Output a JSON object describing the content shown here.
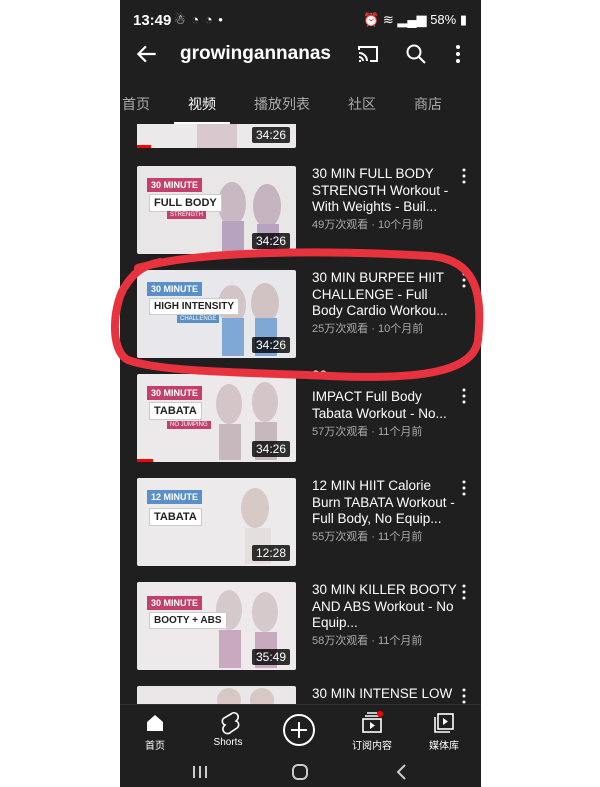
{
  "status": {
    "time": "13:49",
    "battery": "58%",
    "notif_icons": "☃ ◔ ◔ •"
  },
  "header": {
    "channel": "growingannanas"
  },
  "tabs": [
    "首页",
    "视频",
    "播放列表",
    "社区",
    "商店"
  ],
  "active_tab": "视频",
  "videos": [
    {
      "duration": "34:26"
    },
    {
      "title": "30 MIN FULL BODY STRENGTH Workout - With Weights - Buil...",
      "meta": "49万次观看 · 10个月前",
      "duration": "34:26",
      "thumb": {
        "tag": "30 MINUTE",
        "main": "FULL BODY",
        "sub": "STRENGTH"
      }
    },
    {
      "title": "30 MIN BURPEE HIIT CHALLENGE - Full Body Cardio Workou...",
      "meta": "25万次观看 · 10个月前",
      "duration": "34:26",
      "thumb": {
        "tag": "30 MINUTE",
        "main": "HIGH INTENSITY",
        "sub": "CHALLENGE"
      }
    },
    {
      "title_partial": "30",
      "title": "IMPACT Full Body Tabata Workout - No...",
      "meta": "57万次观看 · 11个月前",
      "duration": "34:26",
      "thumb": {
        "tag": "30 MINUTE",
        "main": "TABATA",
        "sub": "NO JUMPING"
      }
    },
    {
      "title": "12 MIN HIIT Calorie Burn TABATA Workout - Full Body, No Equip...",
      "meta": "55万次观看 · 11个月前",
      "duration": "12:28",
      "thumb": {
        "tag": "12 MINUTE",
        "main": "TABATA"
      }
    },
    {
      "title": "30 MIN KILLER BOOTY AND ABS Workout - No Equip...",
      "meta": "58万次观看 · 11个月前",
      "duration": "35:49",
      "thumb": {
        "tag": "30 MINUTE",
        "main": "BOOTY + ABS"
      }
    },
    {
      "title": "30 MIN INTENSE LOW"
    }
  ],
  "bottom_nav": [
    "首页",
    "Shorts",
    "",
    "订阅内容",
    "媒体库"
  ],
  "colors": {
    "highlight_circle": "#e8333f",
    "progress": "#ff0000",
    "tag_pink": "#c2406b",
    "tag_blue": "#5b8fc9"
  }
}
